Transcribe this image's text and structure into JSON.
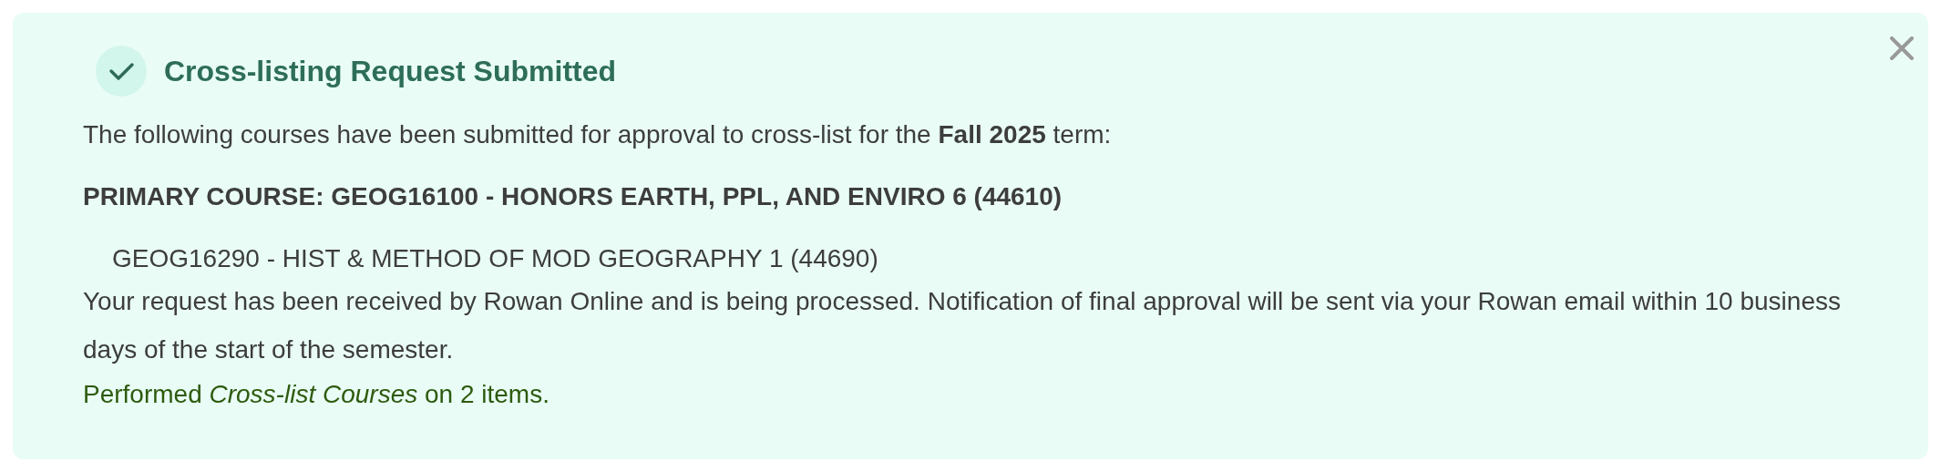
{
  "alert": {
    "title": "Cross-listing Request Submitted",
    "intro": "The following courses have been submitted for approval to cross-list for the **Fall 2025** term:",
    "primary_course": "PRIMARY COURSE: GEOG16100 - HONORS EARTH, PPL, AND ENVIRO 6 (44610)",
    "courses": [
      "GEOG16290 - HIST & METHOD OF MOD GEOGRAPHY 1 (44690)"
    ],
    "message": "Your request has been received by Rowan Online and is being processed. Notification of final approval will be sent via your Rowan email within 10 business days of the start of the semester.",
    "result": "Performed *Cross-list Courses* on 2 items."
  }
}
